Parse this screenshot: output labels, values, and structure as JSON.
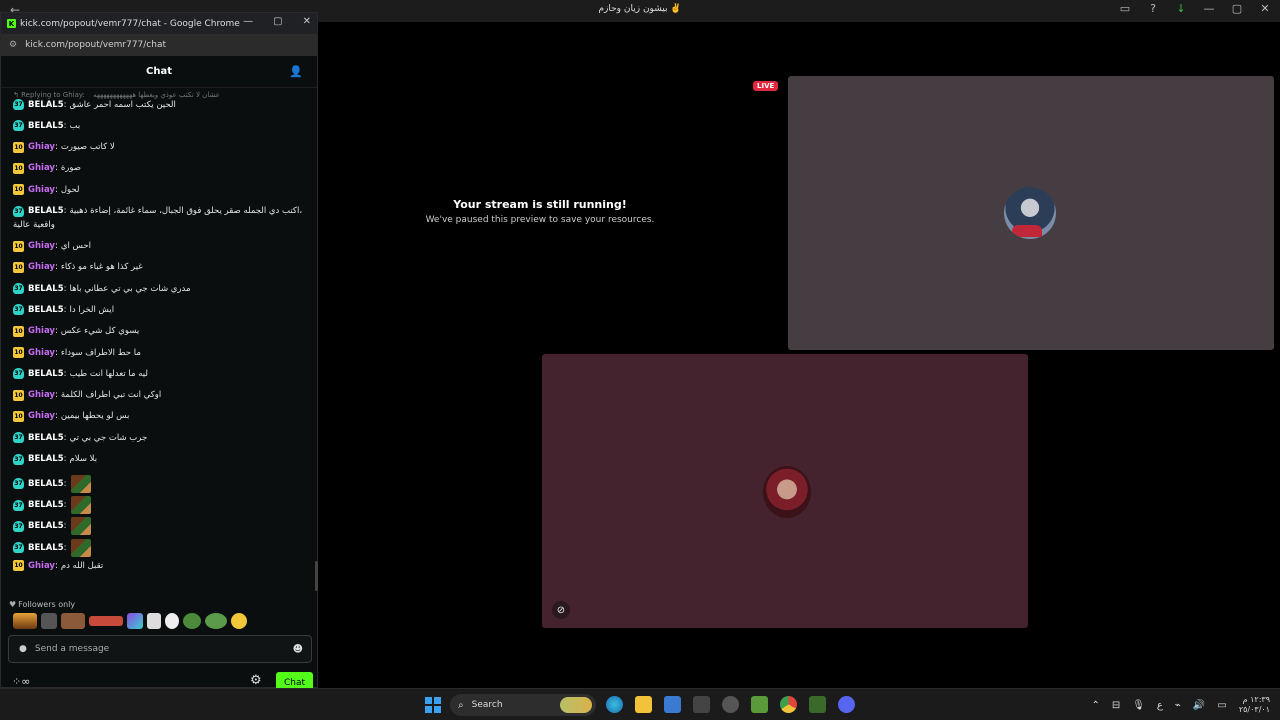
{
  "browser": {
    "tab_title": "بيشون زيان وحازم ✌️",
    "nav_back": "←",
    "nav_forward": "→",
    "actions": [
      "▭",
      "?",
      "↓",
      "—",
      "▢",
      "✕"
    ]
  },
  "popout": {
    "window_title": "kick.com/popout/vemr777/chat - Google Chrome",
    "url": "kick.com/popout/vemr777/chat",
    "controls": [
      "—",
      "▢",
      "✕"
    ],
    "chat_header": "Chat",
    "reply_context": {
      "label": "Replying to Ghiay:",
      "text": "عشان لا تكتب عوذي ويغطها ههههههههههههه"
    },
    "messages": [
      {
        "badge": "37",
        "user": "BELAL5",
        "text": "الحين يكتب اسمه احمر عاشق"
      },
      {
        "badge": "37",
        "user": "BELAL5",
        "text": "بب"
      },
      {
        "badge": "10",
        "user": "Ghiay",
        "text": "لا كاتب صيورت"
      },
      {
        "badge": "10",
        "user": "Ghiay",
        "text": "صورة"
      },
      {
        "badge": "10",
        "user": "Ghiay",
        "text": "لحول"
      },
      {
        "badge": "37",
        "user": "BELAL5",
        "text": "اكتب دي الجمله صقر يحلق فوق الجبال، سماء غائمة، إضاءة ذهبية،",
        "text2": "واقعية عالية"
      },
      {
        "badge": "10",
        "user": "Ghiay",
        "text": "احس اي"
      },
      {
        "badge": "10",
        "user": "Ghiay",
        "text": "غير كذا هو غباء مو ذكاء"
      },
      {
        "badge": "37",
        "user": "BELAL5",
        "text": "مدري شات جي بي تي عطاني باها"
      },
      {
        "badge": "37",
        "user": "BELAL5",
        "text": "ايش الخرا دا"
      },
      {
        "badge": "10",
        "user": "Ghiay",
        "text": "يسوي كل شيء عكس"
      },
      {
        "badge": "10",
        "user": "Ghiay",
        "text": "ما حط الاطراف سوداء"
      },
      {
        "badge": "37",
        "user": "BELAL5",
        "text": "ليه ما تعدلها انت طيب"
      },
      {
        "badge": "10",
        "user": "Ghiay",
        "text": "اوكي انت تبي اطراف الكلمة"
      },
      {
        "badge": "10",
        "user": "Ghiay",
        "text": "بس لو يحطها بيمين"
      },
      {
        "badge": "37",
        "user": "BELAL5",
        "text": "جرب شات جي بي تي"
      },
      {
        "badge": "37",
        "user": "BELAL5",
        "text": "بلا سلام"
      },
      {
        "badge": "37",
        "user": "BELAL5",
        "text": "",
        "emote": true
      },
      {
        "badge": "37",
        "user": "BELAL5",
        "text": "",
        "emote": true
      },
      {
        "badge": "37",
        "user": "BELAL5",
        "text": "",
        "emote": true
      },
      {
        "badge": "37",
        "user": "BELAL5",
        "text": "",
        "emote": true
      },
      {
        "badge": "10",
        "user": "Ghiay",
        "text": "تقبل الله دم"
      }
    ],
    "followers_only": "Followers only",
    "input_placeholder": "Send a message",
    "chat_button": "Chat",
    "bottom_left_icons": "⁘∞",
    "gear_icon": "⚙"
  },
  "stream": {
    "paused_title": "Your stream is still running!",
    "paused_subtitle": "We've paused this preview to save your resources.",
    "live_badge": "LIVE"
  },
  "taskbar": {
    "search_label": "Search",
    "tray_lang": "ع",
    "clock_time": "١٢:٣٩ م",
    "clock_date": "٢٥/٠٣/٠١"
  },
  "colors": {
    "kick_green": "#53fc18",
    "belal_color": "#ffffff",
    "ghiay_color": "#c46cf0",
    "badge_37": "#2fd4c8",
    "badge_10": "#f2c83a",
    "live_red": "#e0283e"
  }
}
